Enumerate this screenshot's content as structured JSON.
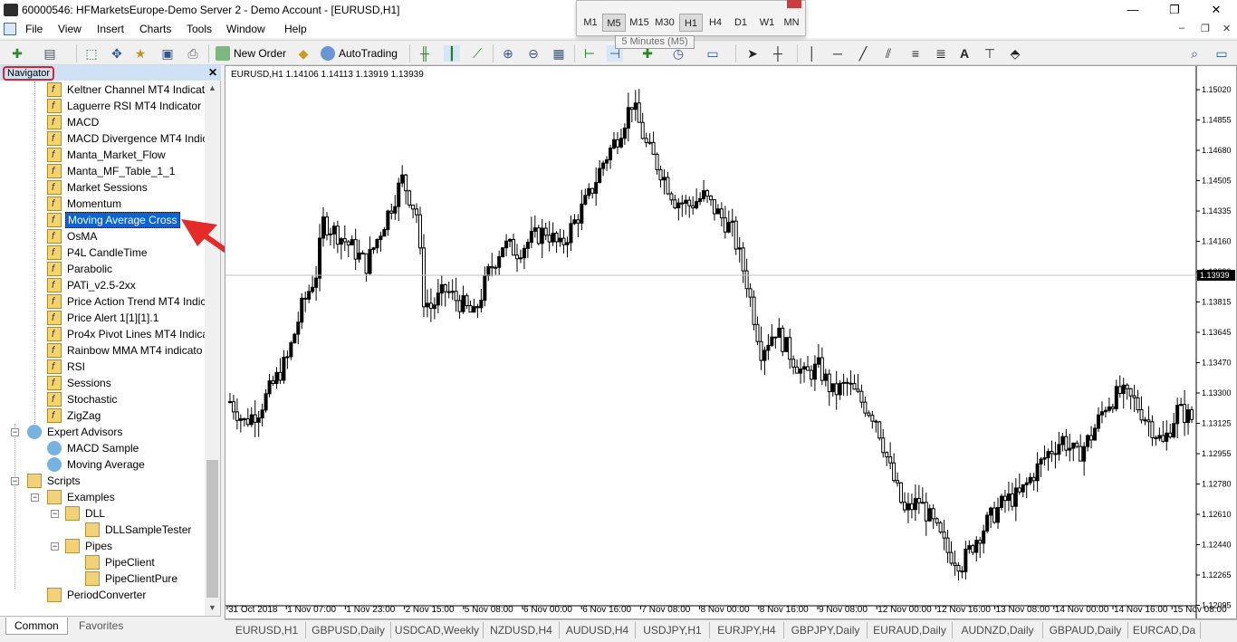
{
  "window": {
    "title": "60000546: HFMarketsEurope-Demo Server 2 - Demo Account - [EURUSD,H1]",
    "minimize": "—",
    "maximize": "❐",
    "close": "✕"
  },
  "menu": {
    "items": [
      "File",
      "View",
      "Insert",
      "Charts",
      "Tools",
      "Window",
      "Help"
    ],
    "mdi_minimize": "–",
    "mdi_restore": "❐",
    "mdi_close": "✕"
  },
  "toolbar": {
    "new_order": "New Order",
    "autotrading": "AutoTrading",
    "text_tool": "A"
  },
  "timeframes": {
    "items": [
      "M1",
      "M5",
      "M15",
      "M30",
      "H1",
      "H4",
      "D1",
      "W1",
      "MN"
    ],
    "active": "M5",
    "tooltip": "5 Minutes (M5)"
  },
  "navigator": {
    "title": "Navigator",
    "close": "✕",
    "indicators": [
      "Keltner Channel MT4 Indicat",
      "Laguerre RSI MT4 Indicator",
      "MACD",
      "MACD Divergence MT4 Indic",
      "Manta_Market_Flow",
      "Manta_MF_Table_1_1",
      "Market Sessions",
      "Momentum",
      "Moving Average Cross",
      "OsMA",
      "P4L CandleTime",
      "Parabolic",
      "PATi_v2.5-2xx",
      "Price Action Trend MT4 Indic",
      "Price Alert 1[1][1].1",
      "Pro4x Pivot Lines MT4 Indica",
      "Rainbow MMA MT4 indicato",
      "RSI",
      "Sessions",
      "Stochastic",
      "ZigZag"
    ],
    "selected": "Moving Average Cross",
    "expert_advisors": {
      "label": "Expert Advisors",
      "items": [
        "MACD Sample",
        "Moving Average"
      ]
    },
    "scripts": {
      "label": "Scripts",
      "examples": "Examples",
      "dll": "DLL",
      "dll_items": [
        "DLLSampleTester"
      ],
      "pipes": "Pipes",
      "pipes_items": [
        "PipeClient",
        "PipeClientPure"
      ],
      "period_converter": "PeriodConverter"
    },
    "tabs": [
      "Common",
      "Favorites"
    ],
    "active_tab": "Common"
  },
  "chart": {
    "info": "EURUSD,H1  1.14106 1.14113 1.13919 1.13939",
    "current_price": "1.13939",
    "bg_color": "#ffffff",
    "candle_color": "#000000",
    "price_line_color": "#c0c0c0",
    "price_ticks": [
      "1.15020",
      "1.14855",
      "1.14680",
      "1.14505",
      "1.14335",
      "1.14160",
      "1.13990",
      "1.13815",
      "1.13645",
      "1.13470",
      "1.13300",
      "1.13125",
      "1.12955",
      "1.12780",
      "1.12610",
      "1.12440",
      "1.12265",
      "1.12095"
    ],
    "time_ticks": [
      "31 Oct 2018",
      "1 Nov 07:00",
      "1 Nov 23:00",
      "2 Nov 15:00",
      "5 Nov 08:00",
      "6 Nov 00:00",
      "6 Nov 16:00",
      "7 Nov 08:00",
      "8 Nov 00:00",
      "8 Nov 16:00",
      "9 Nov 08:00",
      "12 Nov 00:00",
      "12 Nov 16:00",
      "13 Nov 08:00",
      "14 Nov 00:00",
      "14 Nov 16:00",
      "15 Nov 08:00"
    ]
  },
  "chart_tabs": [
    "EURUSD,H1",
    "GBPUSD,Daily",
    "USDCAD,Weekly",
    "NZDUSD,H4",
    "AUDUSD,H4",
    "USDJPY,H1",
    "EURJPY,H4",
    "GBPJPY,Daily",
    "EURAUD,Daily",
    "AUDNZD,Daily",
    "GBPAUD,Daily",
    "EURCAD,Da"
  ],
  "chart_data": {
    "type": "candlestick",
    "series": [
      {
        "name": "EURUSD,H1"
      }
    ],
    "ylim": [
      1.1201,
      1.1511
    ],
    "close_path": [
      [
        0,
        1.132
      ],
      [
        4,
        1.1308
      ],
      [
        8,
        1.1315
      ],
      [
        12,
        1.133
      ],
      [
        16,
        1.1345
      ],
      [
        20,
        1.1375
      ],
      [
        24,
        1.1395
      ],
      [
        26,
        1.1425
      ],
      [
        30,
        1.1418
      ],
      [
        34,
        1.141
      ],
      [
        38,
        1.14
      ],
      [
        42,
        1.142
      ],
      [
        46,
        1.144
      ],
      [
        48,
        1.145
      ],
      [
        52,
        1.143
      ],
      [
        54,
        1.138
      ],
      [
        56,
        1.1375
      ],
      [
        60,
        1.1385
      ],
      [
        64,
        1.1378
      ],
      [
        68,
        1.137
      ],
      [
        72,
        1.1395
      ],
      [
        76,
        1.1412
      ],
      [
        80,
        1.1408
      ],
      [
        84,
        1.1415
      ],
      [
        88,
        1.142
      ],
      [
        92,
        1.141
      ],
      [
        96,
        1.1425
      ],
      [
        100,
        1.144
      ],
      [
        104,
        1.146
      ],
      [
        108,
        1.1475
      ],
      [
        112,
        1.1495
      ],
      [
        116,
        1.147
      ],
      [
        120,
        1.1455
      ],
      [
        124,
        1.1438
      ],
      [
        128,
        1.1435
      ],
      [
        132,
        1.144
      ],
      [
        136,
        1.143
      ],
      [
        140,
        1.142
      ],
      [
        144,
        1.139
      ],
      [
        148,
        1.135
      ],
      [
        152,
        1.1362
      ],
      [
        156,
        1.1348
      ],
      [
        160,
        1.1335
      ],
      [
        164,
        1.134
      ],
      [
        168,
        1.1325
      ],
      [
        172,
        1.133
      ],
      [
        176,
        1.132
      ],
      [
        180,
        1.131
      ],
      [
        184,
        1.128
      ],
      [
        188,
        1.1255
      ],
      [
        192,
        1.1262
      ],
      [
        196,
        1.1248
      ],
      [
        200,
        1.1232
      ],
      [
        204,
        1.1225
      ],
      [
        208,
        1.124
      ],
      [
        212,
        1.1252
      ],
      [
        216,
        1.1262
      ],
      [
        220,
        1.1265
      ],
      [
        224,
        1.1278
      ],
      [
        228,
        1.129
      ],
      [
        232,
        1.1298
      ],
      [
        236,
        1.1288
      ],
      [
        240,
        1.13
      ],
      [
        244,
        1.1318
      ],
      [
        248,
        1.1325
      ],
      [
        252,
        1.132
      ],
      [
        256,
        1.1308
      ],
      [
        260,
        1.1295
      ],
      [
        264,
        1.1315
      ],
      [
        268,
        1.131
      ]
    ]
  }
}
